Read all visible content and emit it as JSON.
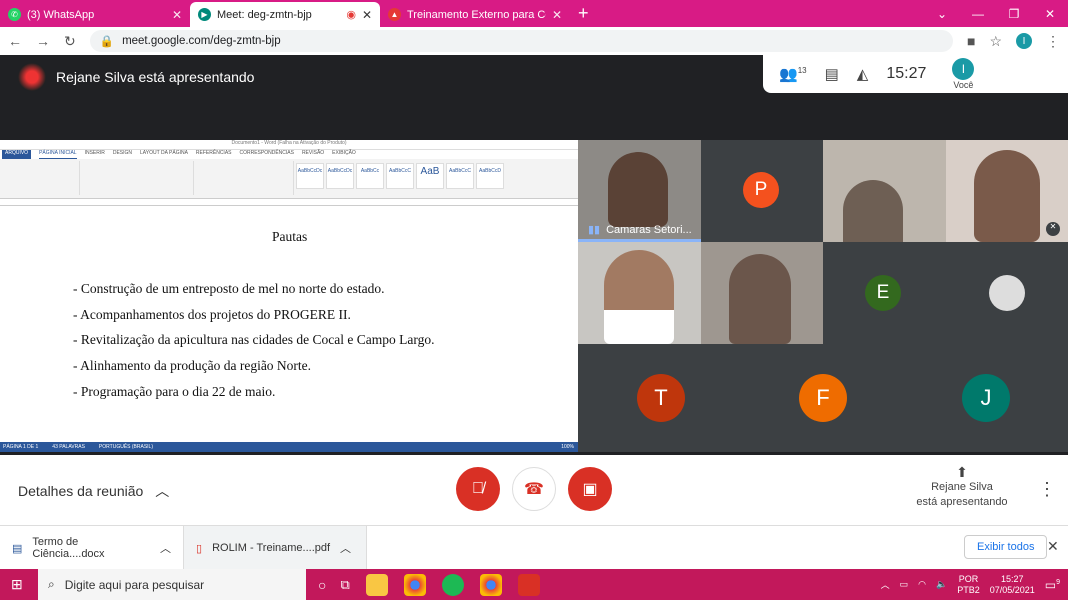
{
  "browser": {
    "tabs": [
      {
        "label": "(3) WhatsApp",
        "color": "#25d366",
        "icon": "whatsapp-icon"
      },
      {
        "label": "Meet: deg-zmtn-bjp",
        "color": "#00897b",
        "icon": "meet-icon"
      },
      {
        "label": "Treinamento Externo para Corres",
        "color": "#e53935",
        "icon": "page-icon"
      }
    ],
    "url": "meet.google.com/deg-zmtn-bjp",
    "profile_initial": "I"
  },
  "meet": {
    "presenter_banner": "Rejane Silva está apresentando",
    "participants_count": "13",
    "clock": "15:27",
    "you_label": "Você",
    "you_initial": "I",
    "document": {
      "title": "Pautas",
      "items": [
        "- Construção de um entreposto de mel no norte do estado.",
        "- Acompanhamentos dos projetos do PROGERE II.",
        "- Revitalização da apicultura nas cidades de Cocal e Campo Largo.",
        "- Alinhamento da produção da região Norte.",
        "- Programação para o dia 22 de maio."
      ],
      "window_title": "Documento1 - Word (Falha na Ativação do Produto)",
      "ribbon_tabs": [
        "ARQUIVO",
        "PÁGINA INICIAL",
        "INSERIR",
        "DESIGN",
        "LAYOUT DA PÁGINA",
        "REFERÊNCIAS",
        "CORRESPONDÊNCIAS",
        "REVISÃO",
        "EXIBIÇÃO"
      ],
      "styles": [
        "AaBbCcDc",
        "AaBbCcDc",
        "AaBbCc",
        "AaBbCcC",
        "AaB",
        "AaBbCcC",
        "AaBbCcD"
      ],
      "status": [
        "PÁGINA 1 DE 1",
        "43 PALAVRAS",
        "PORTUGUÊS (BRASIL)",
        "100%"
      ]
    },
    "tiles": [
      {
        "name": "Camaras Setori...",
        "initial": ""
      },
      {
        "name": "",
        "initial": "P",
        "color": "#f4511e"
      },
      {
        "name": "",
        "initial": ""
      },
      {
        "name": "",
        "initial": ""
      },
      {
        "name": "",
        "initial": ""
      },
      {
        "name": "",
        "initial": ""
      },
      {
        "name": "",
        "initial": "E",
        "color": "#33691e"
      },
      {
        "name": "",
        "initial": ""
      },
      {
        "name": "",
        "initial": "T",
        "color": "#bf360c"
      },
      {
        "name": "",
        "initial": "F",
        "color": "#ef6c00"
      },
      {
        "name": "",
        "initial": "J",
        "color": "#00796b"
      }
    ],
    "details_label": "Detalhes da reunião",
    "presenting_line1": "Rejane Silva",
    "presenting_line2": "está apresentando"
  },
  "downloads": {
    "items": [
      "Termo de Ciência....docx",
      "ROLIM - Treiname....pdf"
    ],
    "show_all": "Exibir todos"
  },
  "taskbar": {
    "search_placeholder": "Digite aqui para pesquisar",
    "lang1": "POR",
    "lang2": "PTB2",
    "time": "15:27",
    "date": "07/05/2021",
    "notif_count": "9"
  }
}
